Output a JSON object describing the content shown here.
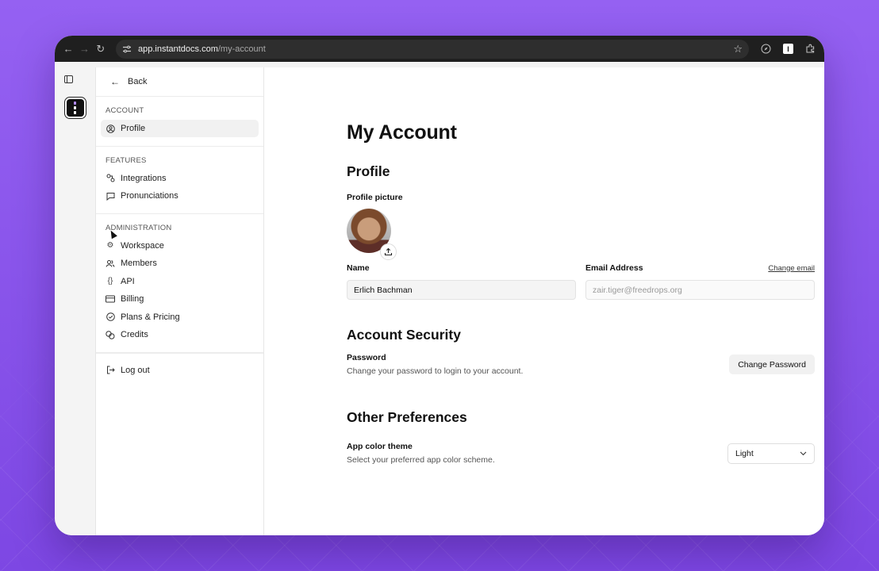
{
  "browser": {
    "url_host": "app.instantdocs.com",
    "url_path": "/my-account",
    "extension_label": "I"
  },
  "sidebar": {
    "back_label": "Back",
    "groups": [
      {
        "heading": "ACCOUNT",
        "items": [
          {
            "label": "Profile",
            "icon": "user-circle-icon",
            "active": true
          }
        ]
      },
      {
        "heading": "FEATURES",
        "items": [
          {
            "label": "Integrations",
            "icon": "integrations-icon"
          },
          {
            "label": "Pronunciations",
            "icon": "chat-bubble-icon"
          }
        ]
      },
      {
        "heading": "ADMINISTRATION",
        "items": [
          {
            "label": "Workspace",
            "icon": "gear-icon"
          },
          {
            "label": "Members",
            "icon": "users-icon"
          },
          {
            "label": "API",
            "icon": "braces-icon"
          },
          {
            "label": "Billing",
            "icon": "credit-card-icon"
          },
          {
            "label": "Plans & Pricing",
            "icon": "check-circle-icon"
          },
          {
            "label": "Credits",
            "icon": "coins-icon"
          }
        ]
      }
    ],
    "logout_label": "Log out"
  },
  "main": {
    "title": "My Account",
    "profile": {
      "section_title": "Profile",
      "picture_label": "Profile picture",
      "name_label": "Name",
      "name_value": "Erlich Bachman",
      "email_label": "Email Address",
      "email_placeholder": "zair.tiger@freedrops.org",
      "change_email_label": "Change email"
    },
    "security": {
      "section_title": "Account Security",
      "password_label": "Password",
      "password_desc": "Change your password to login to your account.",
      "change_password_label": "Change Password"
    },
    "preferences": {
      "section_title": "Other Preferences",
      "theme_label": "App color theme",
      "theme_desc": "Select your preferred app color scheme.",
      "theme_value": "Light"
    }
  }
}
